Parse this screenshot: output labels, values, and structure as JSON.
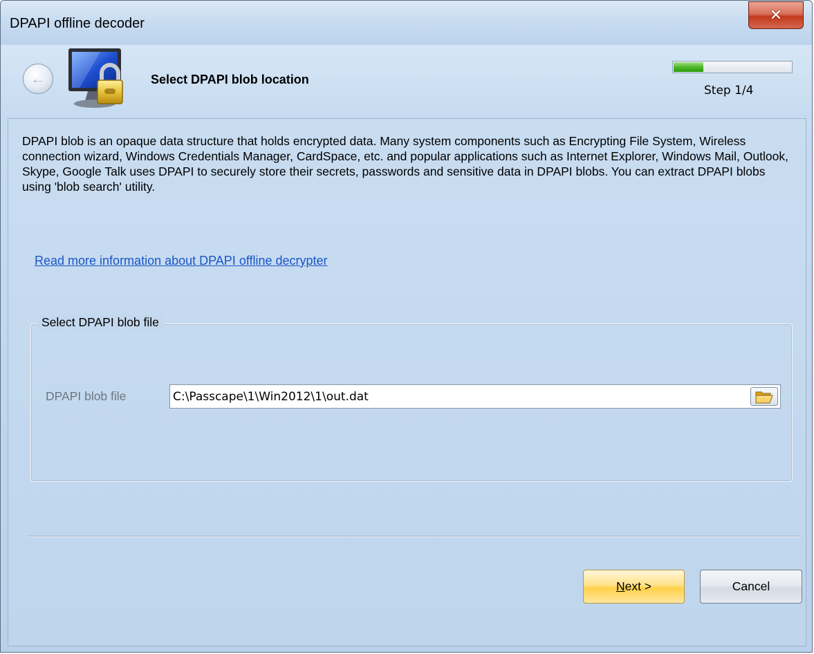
{
  "window": {
    "title": "DPAPI offline decoder",
    "close_glyph": "✕"
  },
  "header": {
    "back_glyph": "←",
    "title": "Select DPAPI blob location",
    "progress_fraction": 0.25,
    "step_text": "Step 1/4",
    "wizard_icon": "monitor-padlock-icon"
  },
  "content": {
    "description": "DPAPI blob is an opaque data structure that holds encrypted data. Many system components such as Encrypting File System, Wireless connection wizard, Windows Credentials Manager, CardSpace, etc. and popular applications such as Internet Explorer, Windows Mail, Outlook, Skype, Google Talk uses DPAPI to securely store their secrets, passwords and sensitive data in DPAPI blobs. You can extract DPAPI blobs using 'blob search' utility.",
    "more_link": "Read more information about DPAPI offline decrypter",
    "group": {
      "legend": "Select DPAPI blob file",
      "field_label": "DPAPI blob file",
      "field_value": "C:\\Passcape\\1\\Win2012\\1\\out.dat",
      "browse_icon": "folder-open-icon"
    }
  },
  "buttons": {
    "next_mnemonic": "N",
    "next_rest": "ext >",
    "cancel": "Cancel"
  },
  "colors": {
    "link": "#1a55c8",
    "progress": "#4fb82a",
    "close": "#c3391d"
  }
}
